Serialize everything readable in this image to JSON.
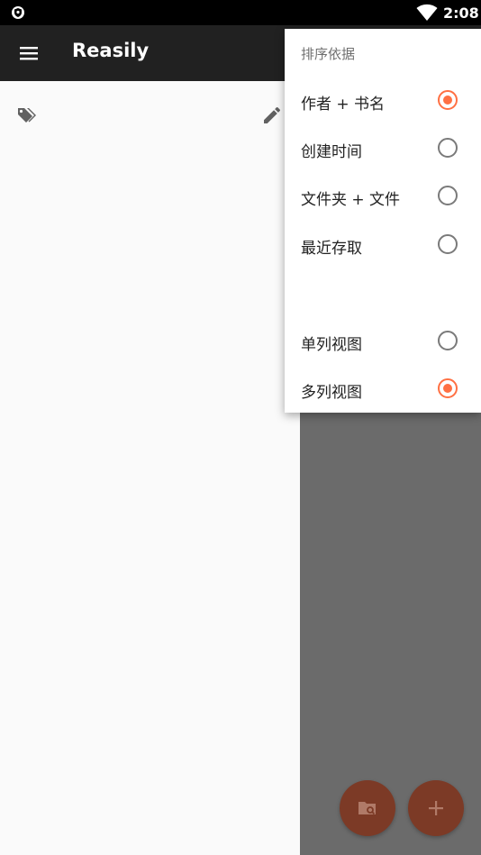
{
  "status_bar": {
    "time": "2:08",
    "left_icon": "shield-icon",
    "right_icon": "wifi-icon"
  },
  "app_bar": {
    "title": "Reasily",
    "menu_icon": "menu-icon"
  },
  "drawer": {
    "tags_icon": "tags-icon",
    "edit_icon": "edit-icon"
  },
  "sort_menu": {
    "header": "排序依据",
    "sort_options": [
      {
        "label": "作者 + 书名",
        "checked": true
      },
      {
        "label": "创建时间",
        "checked": false
      },
      {
        "label": "文件夹 + 文件",
        "checked": false
      },
      {
        "label": "最近存取",
        "checked": false
      }
    ],
    "view_options": [
      {
        "label": "单列视图",
        "checked": false
      },
      {
        "label": "多列视图",
        "checked": true
      }
    ]
  },
  "fabs": {
    "folder_search_icon": "folder-search-icon",
    "add_icon": "plus-icon"
  },
  "colors": {
    "accent": "#ff7043",
    "app_bar": "#212121",
    "fab_dimmed": "#7c3a26",
    "scrim": "#6b6b6b"
  }
}
